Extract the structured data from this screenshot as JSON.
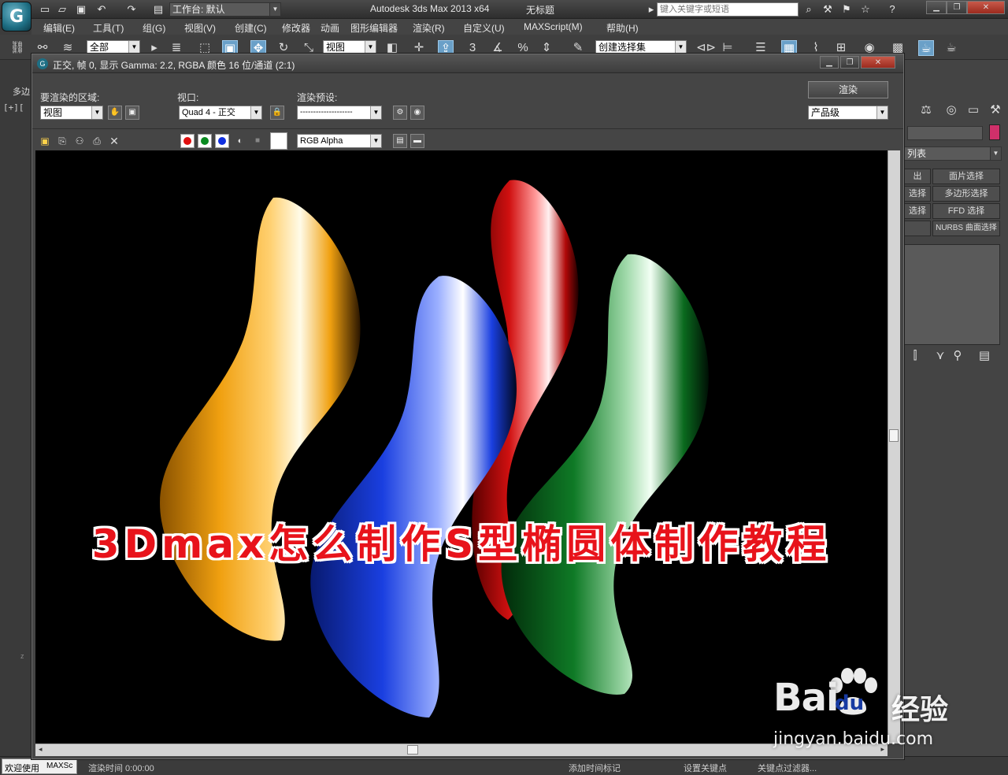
{
  "app": {
    "logo_glyph": "G",
    "title": "Autodesk 3ds Max  2013 x64",
    "document": "无标题",
    "workspace_label": "工作台: 默认",
    "search_placeholder": "键入关键字或短语"
  },
  "menus": [
    "编辑(E)",
    "工具(T)",
    "组(G)",
    "视图(V)",
    "创建(C)",
    "修改器",
    "动画",
    "图形编辑器",
    "渲染(R)",
    "自定义(U)",
    "MAXScript(M)",
    "帮助(H)"
  ],
  "toolbar": {
    "selection_filter": "全部",
    "ref_coord": "视图",
    "named_selection": "创建选择集"
  },
  "left": {
    "tab_label": "多边",
    "viewport_label": "[+][",
    "axis_label": "z"
  },
  "render_window": {
    "title": "正交, 帧 0, 显示 Gamma: 2.2, RGBA 颜色 16 位/通道 (2:1)",
    "area_label": "要渲染的区域:",
    "area_value": "视图",
    "viewport_label": "视口:",
    "viewport_value": "Quad 4 - 正交",
    "preset_label": "渲染预设:",
    "preset_value": "--------------------",
    "render_button": "渲染",
    "quality_value": "产品级",
    "channel_value": "RGB Alpha",
    "overlay_title": "3Dmax怎么制作S型椭圆体制作教程"
  },
  "right_panel": {
    "list_label": "列表",
    "buttons": [
      "面片选择",
      "多边形选择",
      "FFD 选择",
      "NURBS 曲面选择"
    ],
    "partial_buttons": [
      "出",
      "选择",
      "选择"
    ]
  },
  "status": {
    "welcome": "欢迎使用",
    "welcome_suffix": "MAXSc",
    "render_time": "渲染时间 0:00:00",
    "add_time_tag": "添加时间标记",
    "set_key": "设置关键点",
    "key_filter": "关键点过滤器..."
  },
  "watermark": {
    "brand": "Bai",
    "brand_du": "du",
    "cn": "经验",
    "url": "jingyan.baidu.com"
  },
  "shapes": [
    {
      "name": "orange-s-shape",
      "color": "#f0a010"
    },
    {
      "name": "red-s-shape",
      "color": "#d01010"
    },
    {
      "name": "blue-s-shape",
      "color": "#1a3fe0"
    },
    {
      "name": "green-s-shape",
      "color": "#0f7a26"
    }
  ]
}
